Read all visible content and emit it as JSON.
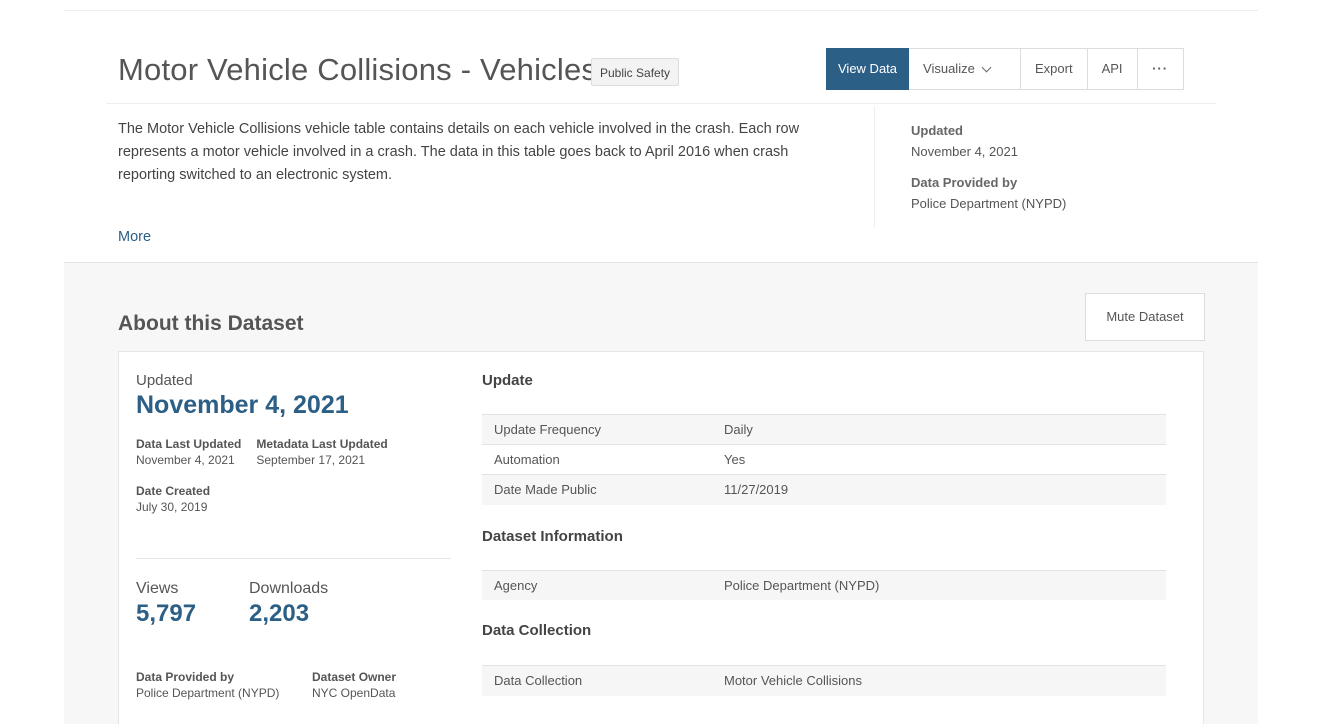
{
  "header": {
    "title": "Motor Vehicle Collisions - Vehicles",
    "category": "Public Safety",
    "actions": {
      "view_data": "View Data",
      "visualize": "Visualize",
      "export": "Export",
      "api": "API",
      "more": "···"
    },
    "description": "The Motor Vehicle Collisions vehicle table contains details on each vehicle involved in the crash. Each row represents a motor vehicle involved in a crash. The data in this table goes back to April 2016 when crash reporting switched to an electronic system.",
    "more_link": "More",
    "meta": {
      "updated_label": "Updated",
      "updated_value": "November 4, 2021",
      "provided_label": "Data Provided by",
      "provided_value": "Police Department (NYPD)"
    }
  },
  "about": {
    "title": "About this Dataset",
    "mute_button": "Mute Dataset",
    "updated_label": "Updated",
    "updated_date": "November 4, 2021",
    "data_last_updated_label": "Data Last Updated",
    "data_last_updated_value": "November 4, 2021",
    "metadata_last_updated_label": "Metadata Last Updated",
    "metadata_last_updated_value": "September 17, 2021",
    "date_created_label": "Date Created",
    "date_created_value": "July 30, 2019",
    "views_label": "Views",
    "views_value": "5,797",
    "downloads_label": "Downloads",
    "downloads_value": "2,203",
    "provided_by_label": "Data Provided by",
    "provided_by_value": "Police Department (NYPD)",
    "owner_label": "Dataset Owner",
    "owner_value": "NYC OpenData"
  },
  "sections": {
    "update": {
      "title": "Update",
      "rows": [
        [
          "Update Frequency",
          "Daily"
        ],
        [
          "Automation",
          "Yes"
        ],
        [
          "Date Made Public",
          "11/27/2019"
        ]
      ]
    },
    "dataset_info": {
      "title": "Dataset Information",
      "rows": [
        [
          "Agency",
          "Police Department (NYPD)"
        ]
      ]
    },
    "data_collection": {
      "title": "Data Collection",
      "rows": [
        [
          "Data Collection",
          "Motor Vehicle Collisions"
        ]
      ]
    }
  },
  "colors": {
    "primary": "#2c5f86",
    "section_bg": "#f7f7f7"
  }
}
